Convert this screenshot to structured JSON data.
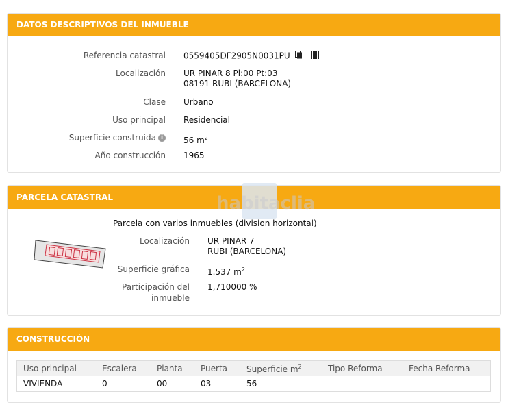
{
  "datos": {
    "header": "DATOS DESCRIPTIVOS DEL INMUEBLE",
    "referencia_label": "Referencia catastral",
    "referencia_value": "0559405DF2905N0031PU",
    "localizacion_label": "Localización",
    "localizacion_line1": "UR PINAR 8 Pl:00 Pt:03",
    "localizacion_line2": "08191 RUBI (BARCELONA)",
    "clase_label": "Clase",
    "clase_value": "Urbano",
    "uso_label": "Uso principal",
    "uso_value": "Residencial",
    "superficie_label": "Superficie construida",
    "superficie_value": "56 m",
    "superficie_unit_sup": "2",
    "ano_label": "Año construcción",
    "ano_value": "1965"
  },
  "parcela": {
    "header": "PARCELA CATASTRAL",
    "subtitle": "Parcela con varios inmuebles (division horizontal)",
    "localizacion_label": "Localización",
    "localizacion_line1": "UR PINAR 7",
    "localizacion_line2": "RUBI (BARCELONA)",
    "superficie_label": "Superficie gráfica",
    "superficie_value": "1.537 m",
    "superficie_unit_sup": "2",
    "participacion_label_line1": "Participación del",
    "participacion_label_line2": "inmueble",
    "participacion_value": "1,710000 %"
  },
  "watermark": {
    "text": "habitaclia"
  },
  "construccion": {
    "header": "CONSTRUCCIÓN",
    "columns": [
      "Uso principal",
      "Escalera",
      "Planta",
      "Puerta",
      "Superficie m",
      "Tipo Reforma",
      "Fecha Reforma"
    ],
    "superficie_col_sup": "2",
    "rows": [
      [
        "VIVIENDA",
        "0",
        "00",
        "03",
        "56",
        "",
        ""
      ]
    ]
  },
  "colors": {
    "header_bg": "#f7a912",
    "header_text": "#ffffff"
  }
}
